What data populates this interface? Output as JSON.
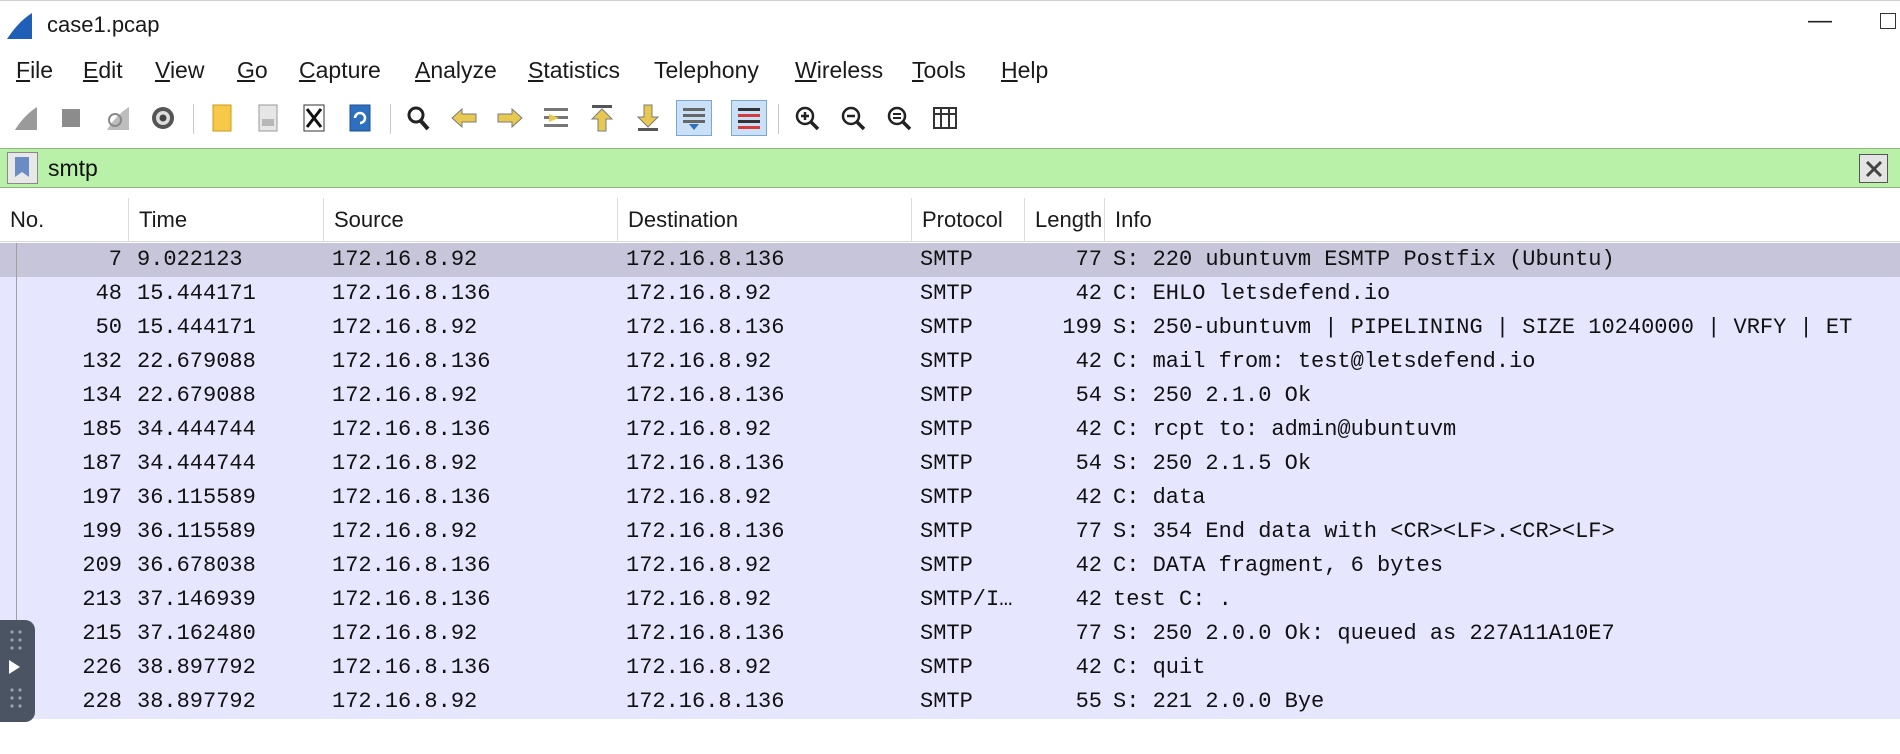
{
  "window": {
    "title": "case1.pcap",
    "minimize_glyph": "—"
  },
  "menu": [
    {
      "label": "File",
      "underline": "F",
      "rest": "ile"
    },
    {
      "label": "Edit",
      "underline": "E",
      "rest": "dit"
    },
    {
      "label": "View",
      "underline": "V",
      "rest": "iew"
    },
    {
      "label": "Go",
      "underline": "G",
      "rest": "o"
    },
    {
      "label": "Capture",
      "underline": "C",
      "rest": "apture"
    },
    {
      "label": "Analyze",
      "underline": "A",
      "rest": "nalyze"
    },
    {
      "label": "Statistics",
      "underline": "S",
      "rest": "tatistics"
    },
    {
      "label": "Telephony",
      "underline": "",
      "rest": "Telephony"
    },
    {
      "label": "Wireless",
      "underline": "W",
      "rest": "ireless"
    },
    {
      "label": "Tools",
      "underline": "T",
      "rest": "ools"
    },
    {
      "label": "Help",
      "underline": "H",
      "rest": "elp"
    }
  ],
  "toolbar_icons": [
    "start-capture-icon",
    "stop-capture-icon",
    "restart-capture-icon",
    "capture-options-icon",
    "open-file-icon",
    "save-file-icon",
    "close-file-icon",
    "reload-file-icon",
    "find-packet-icon",
    "go-back-icon",
    "go-forward-icon",
    "go-to-packet-icon",
    "first-packet-icon",
    "last-packet-icon",
    "autoscroll-icon",
    "colorize-icon",
    "zoom-in-icon",
    "zoom-out-icon",
    "normal-size-icon",
    "resize-columns-icon"
  ],
  "filter": {
    "value": "smtp",
    "background": "#b9f1a9"
  },
  "columns": [
    "No.",
    "Time",
    "Source",
    "Destination",
    "Protocol",
    "Length",
    "Info"
  ],
  "packets": [
    {
      "no": "7",
      "time": "9.022123",
      "source": "172.16.8.92",
      "destination": "172.16.8.136",
      "protocol": "SMTP",
      "length": "77",
      "info": "S: 220 ubuntuvm ESMTP Postfix (Ubuntu)"
    },
    {
      "no": "48",
      "time": "15.444171",
      "source": "172.16.8.136",
      "destination": "172.16.8.92",
      "protocol": "SMTP",
      "length": "42",
      "info": "C: EHLO letsdefend.io"
    },
    {
      "no": "50",
      "time": "15.444171",
      "source": "172.16.8.92",
      "destination": "172.16.8.136",
      "protocol": "SMTP",
      "length": "199",
      "info": "S: 250-ubuntuvm | PIPELINING | SIZE 10240000 | VRFY | ET"
    },
    {
      "no": "132",
      "time": "22.679088",
      "source": "172.16.8.136",
      "destination": "172.16.8.92",
      "protocol": "SMTP",
      "length": "42",
      "info": "C: mail from: test@letsdefend.io"
    },
    {
      "no": "134",
      "time": "22.679088",
      "source": "172.16.8.92",
      "destination": "172.16.8.136",
      "protocol": "SMTP",
      "length": "54",
      "info": "S: 250 2.1.0 Ok"
    },
    {
      "no": "185",
      "time": "34.444744",
      "source": "172.16.8.136",
      "destination": "172.16.8.92",
      "protocol": "SMTP",
      "length": "42",
      "info": "C: rcpt to: admin@ubuntuvm"
    },
    {
      "no": "187",
      "time": "34.444744",
      "source": "172.16.8.92",
      "destination": "172.16.8.136",
      "protocol": "SMTP",
      "length": "54",
      "info": "S: 250 2.1.5 Ok"
    },
    {
      "no": "197",
      "time": "36.115589",
      "source": "172.16.8.136",
      "destination": "172.16.8.92",
      "protocol": "SMTP",
      "length": "42",
      "info": "C: data"
    },
    {
      "no": "199",
      "time": "36.115589",
      "source": "172.16.8.92",
      "destination": "172.16.8.136",
      "protocol": "SMTP",
      "length": "77",
      "info": "S: 354 End data with <CR><LF>.<CR><LF>"
    },
    {
      "no": "209",
      "time": "36.678038",
      "source": "172.16.8.136",
      "destination": "172.16.8.92",
      "protocol": "SMTP",
      "length": "42",
      "info": "C: DATA fragment, 6 bytes"
    },
    {
      "no": "213",
      "time": "37.146939",
      "source": "172.16.8.136",
      "destination": "172.16.8.92",
      "protocol": "SMTP/I…",
      "length": "42",
      "info": "test  C: ."
    },
    {
      "no": "215",
      "time": "37.162480",
      "source": "172.16.8.92",
      "destination": "172.16.8.136",
      "protocol": "SMTP",
      "length": "77",
      "info": "S: 250 2.0.0 Ok: queued as 227A11A10E7"
    },
    {
      "no": "226",
      "time": "38.897792",
      "source": "172.16.8.136",
      "destination": "172.16.8.92",
      "protocol": "SMTP",
      "length": "42",
      "info": "C: quit"
    },
    {
      "no": "228",
      "time": "38.897792",
      "source": "172.16.8.92",
      "destination": "172.16.8.136",
      "protocol": "SMTP",
      "length": "55",
      "info": "S: 221 2.0.0 Bye"
    }
  ],
  "selected_row": 0,
  "colors": {
    "row_bg": "#e7e6ff",
    "selected_bg": "#c7c5da"
  }
}
